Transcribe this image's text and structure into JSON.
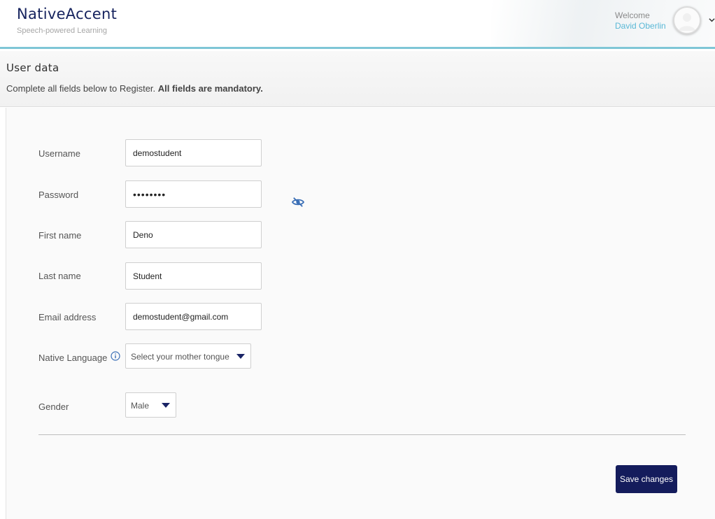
{
  "brand": {
    "name": "NativeAccent",
    "tagline": "Speech-powered Learning"
  },
  "user_menu": {
    "welcome_label": "Welcome",
    "user_name": "David Oberlin"
  },
  "page": {
    "title": "User data",
    "intro_text": "Complete all fields below to Register. ",
    "intro_bold": "All fields are mandatory."
  },
  "form": {
    "username": {
      "label": "Username",
      "value": "demostudent"
    },
    "password": {
      "label": "Password",
      "value": "demopass"
    },
    "first_name": {
      "label": "First name",
      "value": "Deno"
    },
    "last_name": {
      "label": "Last name",
      "value": "Student"
    },
    "email": {
      "label": "Email address",
      "value": "demostudent@gmail.com"
    },
    "native_language": {
      "label": "Native Language",
      "selected": "Select your mother tongue"
    },
    "gender": {
      "label": "Gender",
      "selected": "Male"
    }
  },
  "actions": {
    "save_label": "Save changes"
  },
  "colors": {
    "brand": "#16235e",
    "accent": "#7fc6d6",
    "link": "#5ab8d6",
    "button": "#141c5c"
  },
  "icons": [
    "avatar-icon",
    "chevron-down-icon",
    "eye-slash-icon",
    "info-icon",
    "caret-down-icon"
  ]
}
